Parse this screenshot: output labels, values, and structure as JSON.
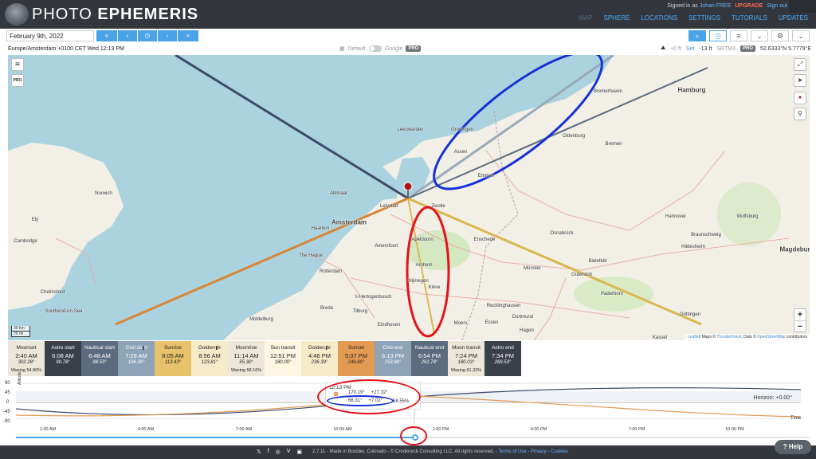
{
  "header": {
    "brand_light": "PHOTO",
    "brand_bold": "EPHEMERIS",
    "signed_in_prefix": "Signed in as",
    "user": "Johan FREE",
    "upgrade": "UPGRADE",
    "sign_out": "Sign out",
    "nav": [
      "MAP",
      "SPHERE",
      "LOCATIONS",
      "SETTINGS",
      "TUTORIALS",
      "UPDATES"
    ],
    "active_nav": "MAP"
  },
  "toolbar": {
    "date": "February 9th, 2022",
    "nav_buttons": [
      "«",
      "‹",
      "◷",
      "›",
      "»"
    ],
    "search_icon": "⌕",
    "clock_icon": "◷",
    "menu_icon": "≡",
    "caret_icon": "⌄",
    "gear_icon": "⚙"
  },
  "infobar": {
    "timezone": "Europe/Amsterdam +0100 CET Wed 12:13 PM",
    "map_default": "Default",
    "map_google": "Google",
    "pro": "PRO",
    "elev_marker": "+0 ft",
    "set": "Set",
    "elevation": "-13 ft",
    "srtm": "SRTM3",
    "coords": "52.6333°N 5.7779°E"
  },
  "map": {
    "controls": {
      "layers": "≋",
      "pro": "PRO",
      "locate": "➤",
      "pin": "📍",
      "pin2": "⚲",
      "zoom_in": "+",
      "zoom_out": "−"
    },
    "scale": [
      "30 km",
      "20 mi"
    ],
    "attribution": {
      "leaflet": "Leaflet",
      "maps": "| Maps © ",
      "thunderforest": "Thunderforest",
      "data": ", Data © ",
      "osm": "OpenStreetMap",
      "contrib": " contributors"
    },
    "labels": {
      "bremerhaven": "Bremerhaven",
      "hamburg": "Hamburg",
      "leeuwarden": "Leeuwarden",
      "groningen": "Groningen",
      "oldenburg": "Oldenburg",
      "bremen": "Bremen",
      "assen": "Assen",
      "emmen": "Emmen",
      "norwich": "Norwich",
      "alkmaar": "Alkmaar",
      "lelystad": "Lelystad",
      "zwolle": "Zwolle",
      "amsterdam": "Amsterdam",
      "haarlem": "Haarlem",
      "apeldoorn": "Apeldoorn",
      "enschede": "Enschede",
      "osnabruck": "Osnabrück",
      "hannover": "Hannover",
      "wolfsburg": "Wolfsburg",
      "braunschweig": "Braunschweig",
      "ely": "Ely",
      "cambridge": "Cambridge",
      "thehague": "The Hague",
      "amersfoort": "Amersfoort",
      "arnhem": "Arnhem",
      "bielefeld": "Bielefeld",
      "hildesheim": "Hildesheim",
      "magdeburg": "Magdeburg",
      "rotterdam": "Rotterdam",
      "nijmegen": "Nijmegen",
      "munster": "Münster",
      "gutersloh": "Gütersloh",
      "chelmsford": "Chelmsford",
      "hertogenbosch": "'s-Hertogenbosch",
      "kleve": "Kleve",
      "paderborn": "Paderborn",
      "southend": "Southend-on-Sea",
      "tilburg": "Tilburg",
      "recklinghausen": "Recklinghausen",
      "middelburg": "Middelburg",
      "essen": "Essen",
      "dortmund": "Dortmund",
      "gottingen": "Göttingen",
      "eindhoven": "Eindhoven",
      "kassel": "Kassel",
      "moers": "Moers",
      "hagen": "Hagen",
      "breda": "Breda"
    }
  },
  "events": [
    {
      "label": "Moonset",
      "icon": "⬇",
      "time": "2:40 AM",
      "az": "302.28°",
      "extra": "Waxing 54.80%",
      "bg": "#ece7d9",
      "fg": "#222"
    },
    {
      "label": "Astro start",
      "time": "6:08 AM",
      "az": "90.78°",
      "bg": "#3a3f48",
      "fg": "#fff"
    },
    {
      "label": "Nautical start",
      "time": "6:48 AM",
      "az": "98.53°",
      "bg": "#5d6b7e",
      "fg": "#fff"
    },
    {
      "label": "Civil start",
      "time": "7:28 AM",
      "az": "106.36°",
      "bg": "#8fa3b8",
      "fg": "#fff"
    },
    {
      "label": "Sunrise",
      "icon": "⬆",
      "time": "8:05 AM",
      "az": "113.43°",
      "bg": "#e8c16b",
      "fg": "#222"
    },
    {
      "label": "Golden hr",
      "time": "8:56 AM",
      "az": "123.81°",
      "bg": "#f6ebc9",
      "fg": "#222"
    },
    {
      "label": "Moonrise",
      "icon": "⬆",
      "time": "11:14 AM",
      "az": "55.30°",
      "extra": "Waxing 58.16%",
      "bg": "#ece7d9",
      "fg": "#222"
    },
    {
      "label": "Sun transit",
      "time": "12:51 PM",
      "az": "180.00°",
      "bg": "#fdf6e3",
      "fg": "#222"
    },
    {
      "label": "Golden hr",
      "time": "4:46 PM",
      "az": "236.39°",
      "bg": "#f6ebc9",
      "fg": "#222"
    },
    {
      "label": "Sunset",
      "icon": "⬇",
      "time": "5:37 PM",
      "az": "246.80°",
      "bg": "#e39a52",
      "fg": "#222"
    },
    {
      "label": "Civil end",
      "time": "6:13 PM",
      "az": "253.88°",
      "bg": "#8fa3b8",
      "fg": "#fff"
    },
    {
      "label": "Nautical end",
      "time": "6:54 PM",
      "az": "261.74°",
      "bg": "#5d6b7e",
      "fg": "#fff"
    },
    {
      "label": "Moon transit",
      "time": "7:24 PM",
      "az": "180.03°",
      "extra": "Waxing 61.32%",
      "bg": "#ece7d9",
      "fg": "#222"
    },
    {
      "label": "Astro end",
      "time": "7:34 PM",
      "az": "269.53°",
      "bg": "#3a3f48",
      "fg": "#fff"
    }
  ],
  "graph": {
    "y_axis_label": "Altitude",
    "y_ticks": [
      "90",
      "45",
      "0",
      "-45",
      "-90"
    ],
    "popup_time": "12:13 PM",
    "sun_row": [
      "170.19°",
      "+27.32°"
    ],
    "moon_row": [
      "66.31°",
      "+7.02°"
    ],
    "moon_illum": "58.55%",
    "horizon": "Horizon: +0.00°",
    "time_label": "Time",
    "ticks": [
      "1:00 AM",
      "4:00 AM",
      "7:00 AM",
      "10:00 AM",
      "1:00 PM",
      "4:00 PM",
      "7:00 PM",
      "10:00 PM"
    ]
  },
  "footer": {
    "icons": [
      "𝕏",
      "f",
      "◎",
      "V",
      "▣"
    ],
    "version": "2.7.11 - Made in Boulder, Colorado - © Crookneck Consulting LLC. All rights reserved. - ",
    "terms": "Terms of Use",
    "privacy": "Privacy",
    "cookies": "Cookies",
    "sep": " - ",
    "help": "Help"
  },
  "colors": {
    "header_bg": "#33373d",
    "accent": "#4aa3e6",
    "annotation_red": "#e4121a",
    "annotation_blue": "#1530d8"
  }
}
